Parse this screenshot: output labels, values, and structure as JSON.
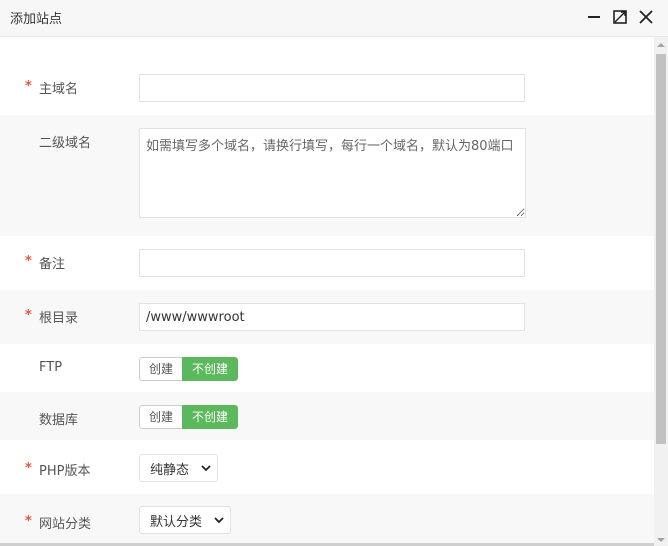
{
  "dialog": {
    "title": "添加站点"
  },
  "icons": {
    "minimize": "minimize-icon",
    "maximize": "maximize-icon",
    "close": "close-icon",
    "required": "*"
  },
  "form": {
    "domain": {
      "label": "主域名",
      "value": "",
      "placeholder": ""
    },
    "subdomain": {
      "label": "二级域名",
      "placeholder": "如需填写多个域名，请换行填写，每行一个域名，默认为80端口"
    },
    "remark": {
      "label": "备注",
      "value": "",
      "placeholder": ""
    },
    "root": {
      "label": "根目录",
      "value": "/www/wwwroot"
    },
    "ftp": {
      "label": "FTP",
      "create": "创建",
      "no_create": "不创建"
    },
    "database": {
      "label": "数据库",
      "create": "创建",
      "no_create": "不创建"
    },
    "php": {
      "label": "PHP版本",
      "selected": "纯静态"
    },
    "category": {
      "label": "网站分类",
      "selected": "默认分类"
    }
  },
  "colors": {
    "accent": "#5cb85c",
    "required": "#e8553e"
  }
}
